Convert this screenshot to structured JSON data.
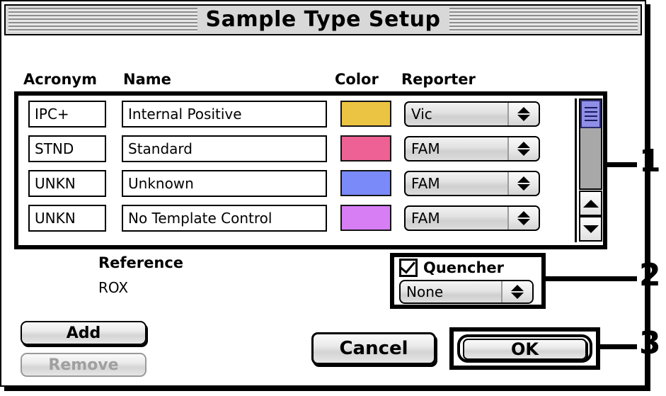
{
  "window": {
    "title": "Sample Type Setup"
  },
  "table": {
    "columns": [
      "Acronym",
      "Name",
      "Color",
      "Reporter"
    ],
    "rows": [
      {
        "acronym": "IPC+",
        "name": "Internal Positive",
        "color": "#ECC443",
        "reporter": "Vic"
      },
      {
        "acronym": "STND",
        "name": "Standard",
        "color": "#EE6194",
        "reporter": "FAM"
      },
      {
        "acronym": "UNKN",
        "name": "Unknown",
        "color": "#7A8AF8",
        "reporter": "FAM"
      },
      {
        "acronym": "UNKN",
        "name": "No Template Control",
        "color": "#D77EF5",
        "reporter": "FAM"
      }
    ],
    "scrollbar": {
      "thumb_icon": "scroll-thumb-lines-icon",
      "up_icon": "triangle-up-icon",
      "down_icon": "triangle-down-icon"
    }
  },
  "reference": {
    "label": "Reference",
    "value": "ROX"
  },
  "quencher": {
    "label": "Quencher",
    "checked": true,
    "selected": "None"
  },
  "buttons": {
    "add": "Add",
    "remove": "Remove",
    "cancel": "Cancel",
    "ok": "OK"
  },
  "annotations": {
    "one": "1",
    "two": "2",
    "three": "3"
  },
  "colors": {
    "window_bg": "#FFFFFF",
    "titlebar_bg": "#D8D8D8",
    "control_gray": "#E2E2E2",
    "scroll_thumb": "#8F8FE8",
    "scroll_track": "#A8A8A8",
    "disabled_text": "#9F9F9F"
  }
}
